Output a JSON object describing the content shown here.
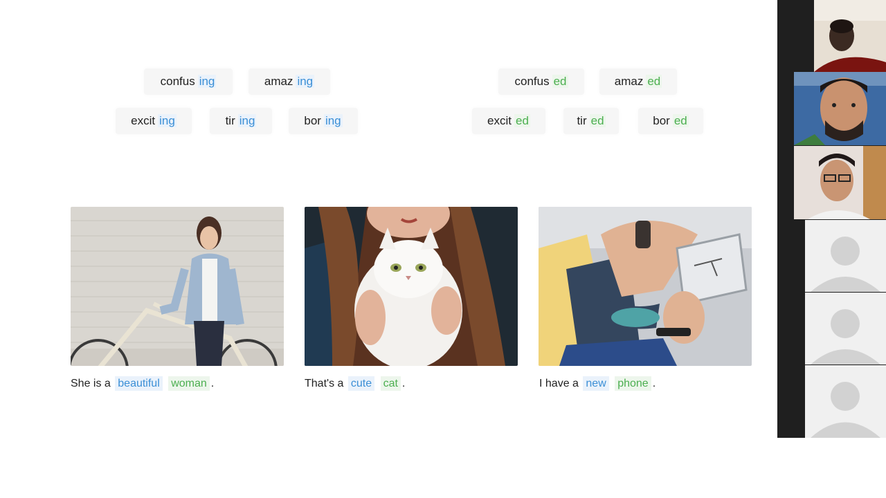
{
  "slide": {
    "ing_words": [
      {
        "stem": "confus",
        "suffix": "ing"
      },
      {
        "stem": "amaz",
        "suffix": "ing"
      },
      {
        "stem": "excit",
        "suffix": "ing"
      },
      {
        "stem": "tir",
        "suffix": "ing"
      },
      {
        "stem": "bor",
        "suffix": "ing"
      }
    ],
    "ed_words": [
      {
        "stem": "confus",
        "suffix": "ed"
      },
      {
        "stem": "amaz",
        "suffix": "ed"
      },
      {
        "stem": "excit",
        "suffix": "ed"
      },
      {
        "stem": "tir",
        "suffix": "ed"
      },
      {
        "stem": "bor",
        "suffix": "ed"
      }
    ],
    "examples": [
      {
        "prefix": "She is a",
        "adjective": "beautiful",
        "noun": "woman",
        "end": "."
      },
      {
        "prefix": "That's a",
        "adjective": "cute",
        "noun": "cat",
        "end": "."
      },
      {
        "prefix": "I have a",
        "adjective": "new",
        "noun": "phone",
        "end": "."
      }
    ]
  },
  "colors": {
    "ing_suffix": "#3b8fd6",
    "ed_suffix": "#4caf50",
    "gallery_bg": "#1f1f1f"
  },
  "participants": {
    "video_tiles": [
      "participant-1",
      "participant-2",
      "participant-3"
    ],
    "placeholder_count": 3
  }
}
